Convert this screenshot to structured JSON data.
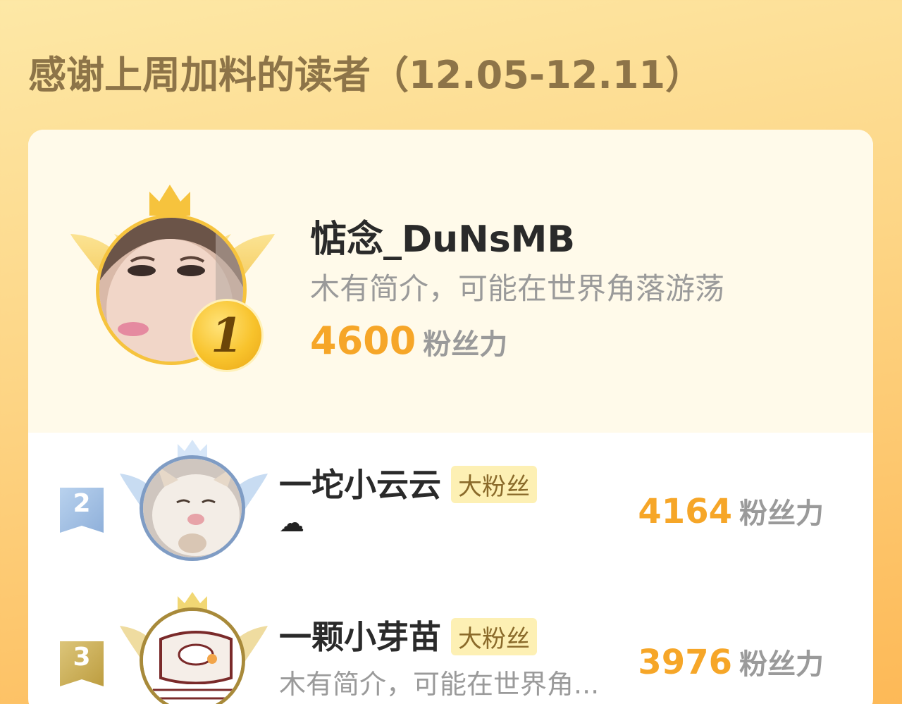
{
  "page": {
    "title": "感谢上周加料的读者（12.05-12.11）"
  },
  "leaderboard": {
    "first": {
      "rank": "1",
      "name": "惦念_DuNsMB",
      "bio": "木有简介，可能在世界角落游荡",
      "score": "4600",
      "score_unit": "粉丝力"
    },
    "rows": [
      {
        "rank": "2",
        "name": "一坨小云云",
        "badge": "大粉丝",
        "bio": "☁",
        "score": "4164",
        "score_unit": "粉丝力"
      },
      {
        "rank": "3",
        "name": "一颗小芽苗",
        "badge": "大粉丝",
        "bio": "木有简介，可能在世界角...",
        "score": "3976",
        "score_unit": "粉丝力"
      }
    ]
  },
  "colors": {
    "background_top": "#fde8a6",
    "background_bottom": "#fdb957",
    "title": "#8d7448",
    "score": "#f6a628",
    "gold": "#f6c33d",
    "silver": "#9bbbe0",
    "bronze": "#c9a94a"
  },
  "icons": {
    "rank1_wings": "gold-crown-wings-icon",
    "rank2_wings": "silver-crown-wings-icon",
    "rank3_wings": "bronze-crown-wings-icon"
  }
}
